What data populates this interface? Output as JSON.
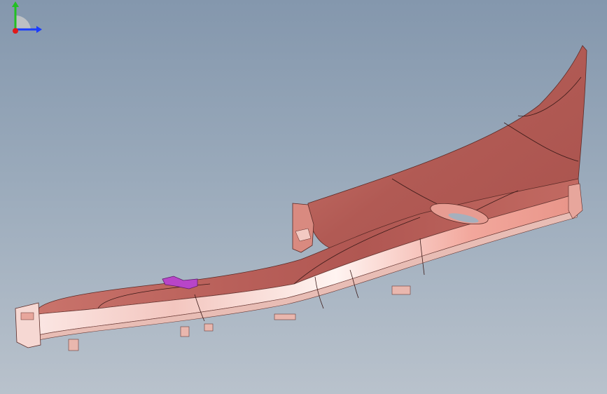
{
  "viewport": {
    "background_top": "#8497ad",
    "background_bottom": "#b9c2cc"
  },
  "model": {
    "part_color": "#c86a62",
    "part_highlight": "#fde6e2",
    "clip_color": "#b845c8",
    "edge_color": "#3a1a18"
  },
  "triad": {
    "x_color": "#1a3cff",
    "y_color": "#22c022",
    "z_color": "#e01a1a",
    "x_icon": "x-axis-arrow-icon",
    "y_icon": "y-axis-arrow-icon",
    "z_icon": "z-axis-origin-icon"
  }
}
